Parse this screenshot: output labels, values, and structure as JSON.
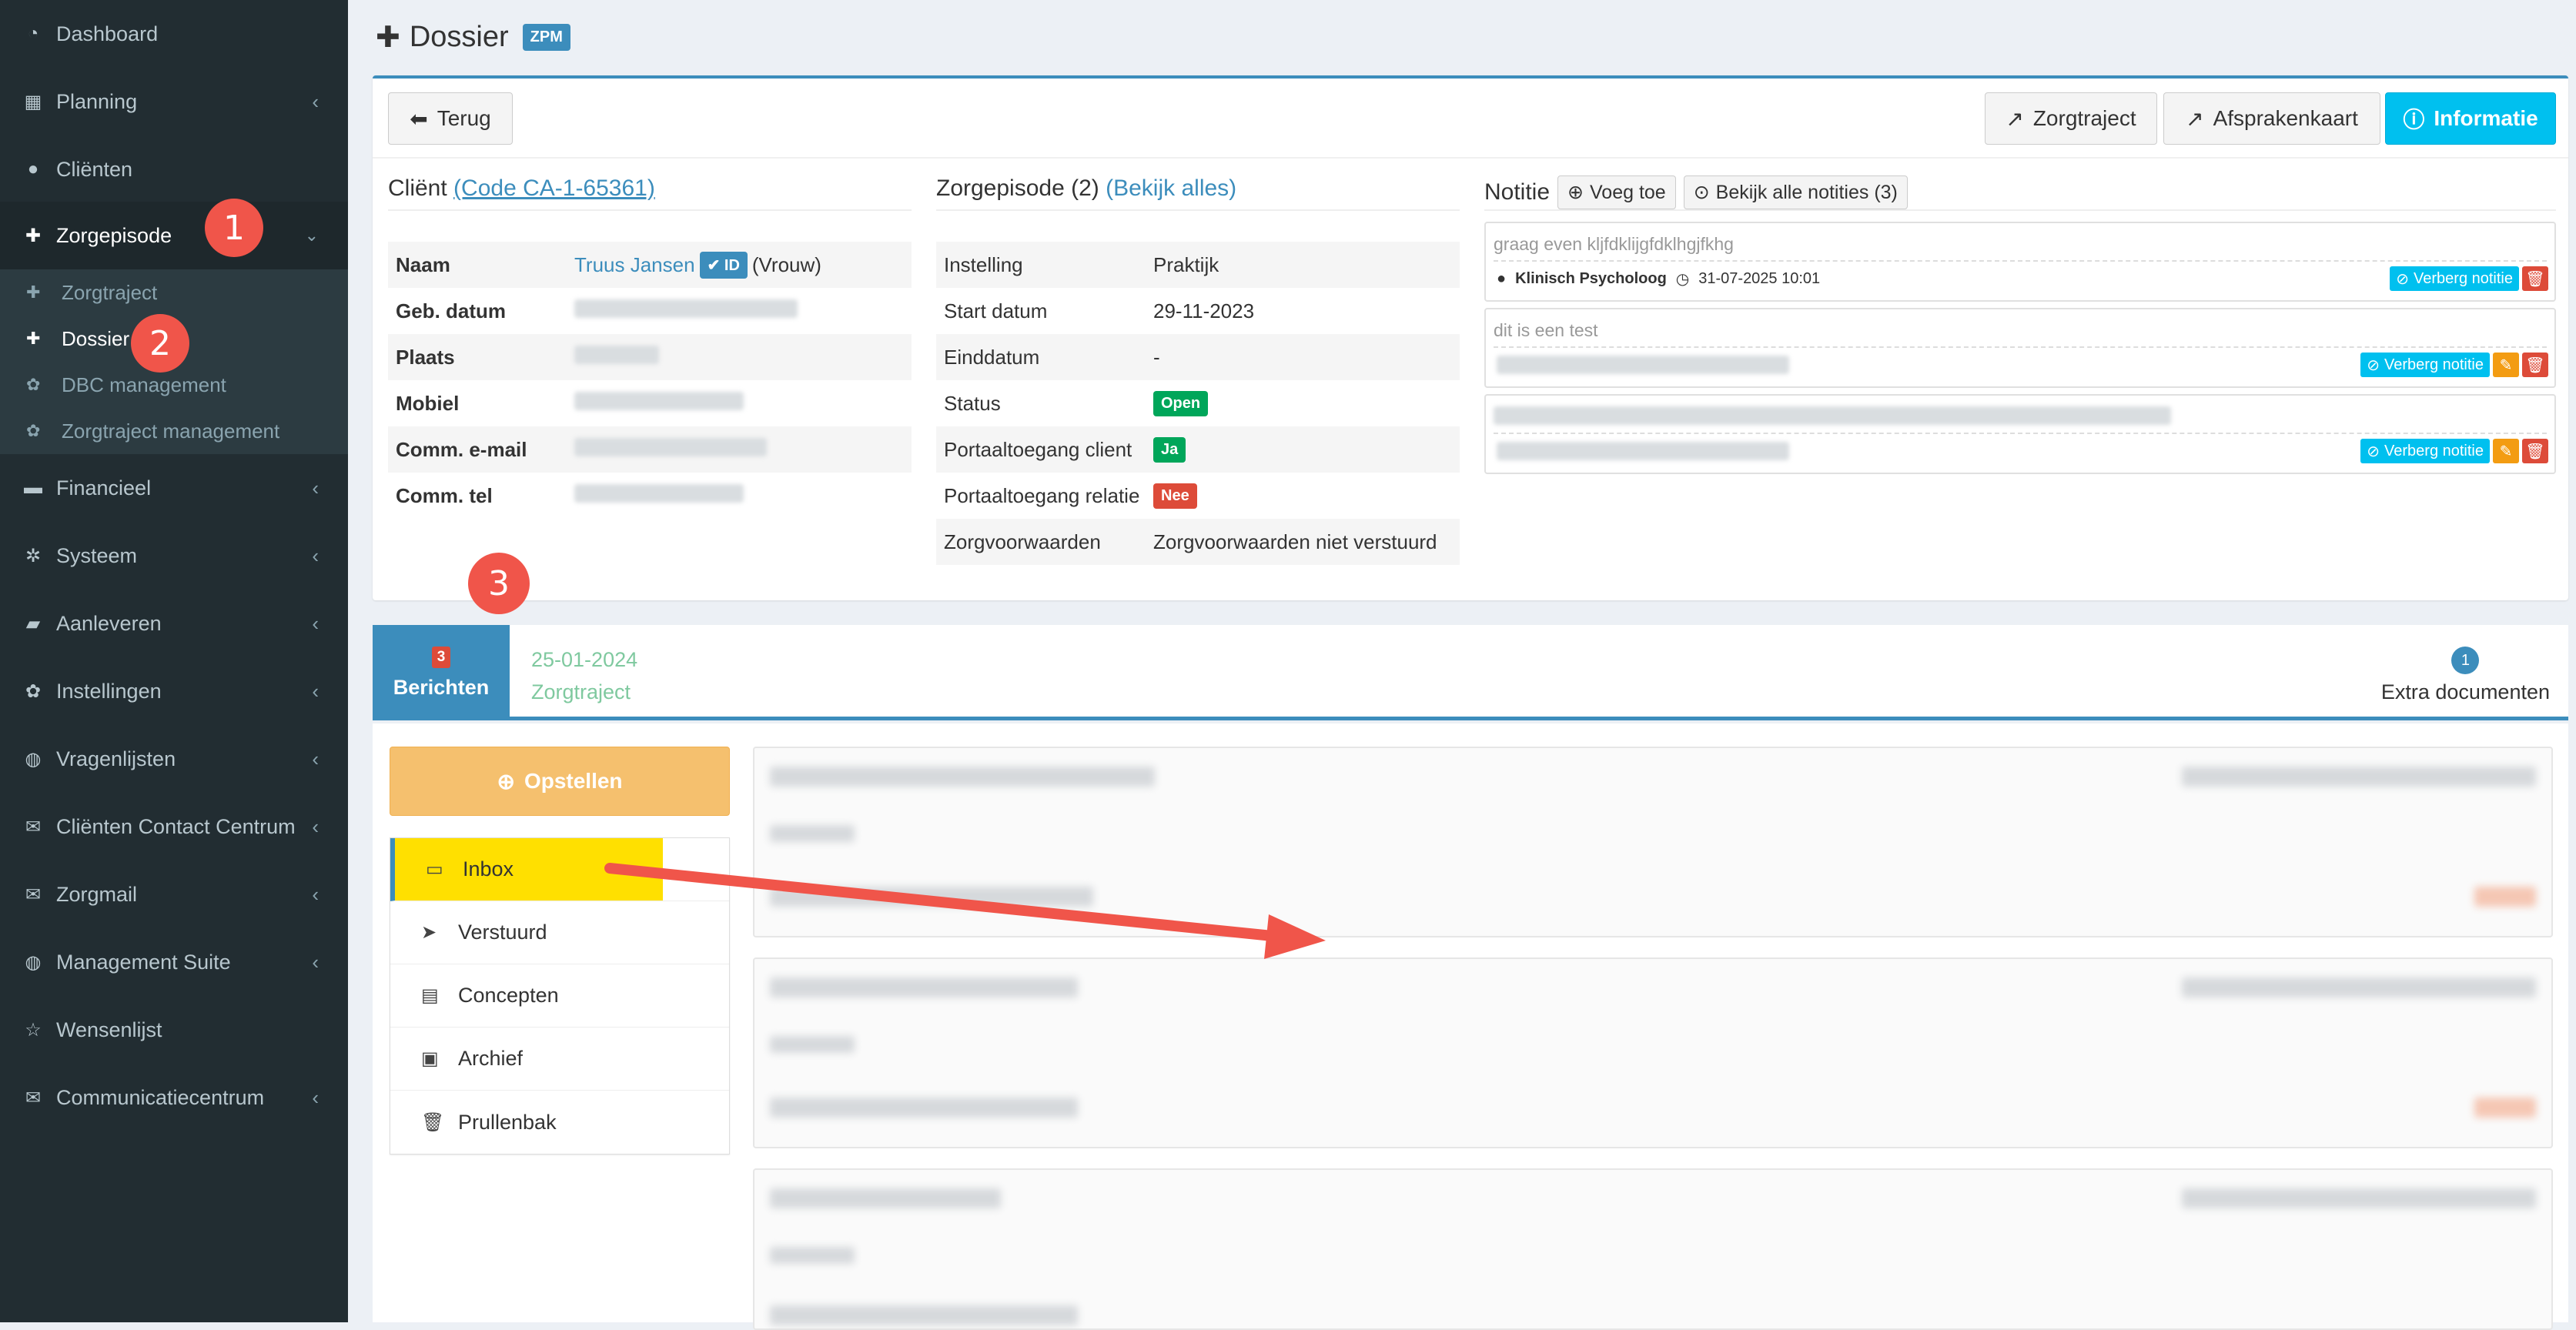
{
  "sidebar": {
    "items": [
      {
        "label": "Dashboard",
        "icon": "dashboard-icon"
      },
      {
        "label": "Planning",
        "icon": "calendar-icon"
      },
      {
        "label": "Cliënten",
        "icon": "user-icon"
      },
      {
        "label": "Zorgepisode",
        "icon": "medkit-icon"
      },
      {
        "label": "Financieel",
        "icon": "book-icon"
      },
      {
        "label": "Systeem",
        "icon": "cogs-icon"
      },
      {
        "label": "Aanleveren",
        "icon": "truck-icon"
      },
      {
        "label": "Instellingen",
        "icon": "gear-icon"
      },
      {
        "label": "Vragenlijsten",
        "icon": "globe-icon"
      },
      {
        "label": "Cliënten Contact Centrum",
        "icon": "envelope-icon"
      },
      {
        "label": "Zorgmail",
        "icon": "envelope-icon"
      },
      {
        "label": "Management Suite",
        "icon": "globe-icon"
      },
      {
        "label": "Wensenlijst",
        "icon": "star-icon"
      },
      {
        "label": "Communicatiecentrum",
        "icon": "envelope-icon"
      }
    ],
    "submenu": [
      {
        "label": "Zorgtraject"
      },
      {
        "label": "Dossier"
      },
      {
        "label": "DBC management"
      },
      {
        "label": "Zorgtraject management"
      }
    ]
  },
  "annotations": {
    "one": "1",
    "two": "2",
    "three": "3"
  },
  "page": {
    "title": "Dossier",
    "badge": "ZPM"
  },
  "toolbar": {
    "back": "Terug",
    "zorgtraject": "Zorgtraject",
    "afsprakenkaart": "Afsprakenkaart",
    "informatie": "Informatie"
  },
  "client": {
    "title": "Cliënt",
    "code": "(Code CA-1-65361)",
    "rows": [
      {
        "key": "Naam",
        "value": "Truus Jansen",
        "id_badge": "ID",
        "extra": "(Vrouw)"
      },
      {
        "key": "Geb. datum"
      },
      {
        "key": "Plaats"
      },
      {
        "key": "Mobiel"
      },
      {
        "key": "Comm. e-mail"
      },
      {
        "key": "Comm. tel"
      }
    ]
  },
  "episode": {
    "title": "Zorgepisode (2)",
    "link": "(Bekijk alles)",
    "rows": [
      {
        "key": "Instelling",
        "value": "Praktijk"
      },
      {
        "key": "Start datum",
        "value": "29-11-2023"
      },
      {
        "key": "Einddatum",
        "value": "-"
      },
      {
        "key": "Status",
        "value": "Open"
      },
      {
        "key": "Portaaltoegang client",
        "value": "Ja"
      },
      {
        "key": "Portaaltoegang relatie",
        "value": "Nee"
      },
      {
        "key": "Zorgvoorwaarden",
        "value": "Zorgvoorwaarden niet verstuurd"
      }
    ]
  },
  "notes": {
    "title": "Notitie",
    "add": "Voeg toe",
    "view_all": "Bekijk alle notities (3)",
    "items": [
      {
        "text": "graag even kljfdklijgfdklhgjfkhg",
        "author": "Klinisch Psycholoog",
        "date": "31-07-2025 10:01",
        "hide": "Verberg notitie"
      },
      {
        "text": "dit is een test",
        "hide": "Verberg notitie"
      },
      {
        "text": "",
        "hide": "Verberg notitie"
      }
    ]
  },
  "tabs": {
    "berichten": {
      "count": "3",
      "label": "Berichten"
    },
    "zorgtraject": {
      "date": "25-01-2024",
      "label": "Zorgtraject"
    },
    "extra": {
      "count": "1",
      "label": "Extra documenten"
    }
  },
  "mail": {
    "compose": "Opstellen",
    "folders": [
      {
        "label": "Inbox",
        "icon": "inbox-icon"
      },
      {
        "label": "Verstuurd",
        "icon": "paper-plane-icon"
      },
      {
        "label": "Concepten",
        "icon": "file-icon"
      },
      {
        "label": "Archief",
        "icon": "archive-icon"
      },
      {
        "label": "Prullenbak",
        "icon": "trash-icon"
      }
    ]
  },
  "colors": {
    "sidebar": "#222d32",
    "accent": "#3c8dbc",
    "info": "#00c0ef",
    "highlight": "#ffe000",
    "annotation": "#f0554a"
  }
}
